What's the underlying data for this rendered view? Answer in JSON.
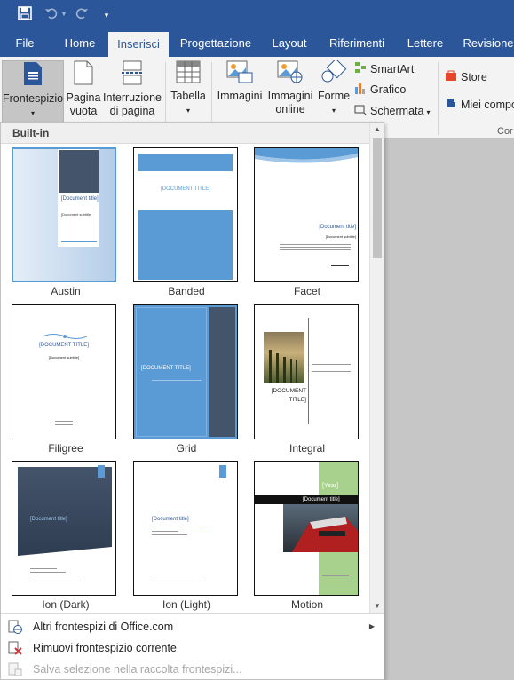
{
  "qat": {
    "save_icon": "save-icon",
    "undo_icon": "undo-icon",
    "redo_icon": "redo-icon",
    "customize": "▾"
  },
  "tabs": [
    {
      "label": "File"
    },
    {
      "label": "Home"
    },
    {
      "label": "Inserisci"
    },
    {
      "label": "Progettazione"
    },
    {
      "label": "Layout"
    },
    {
      "label": "Riferimenti"
    },
    {
      "label": "Lettere"
    },
    {
      "label": "Revisione"
    }
  ],
  "ribbon": {
    "frontespizio": "Frontespizio",
    "pagina_vuota_1": "Pagina",
    "pagina_vuota_2": "vuota",
    "interruzione_1": "Interruzione",
    "interruzione_2": "di pagina",
    "tabella": "Tabella",
    "immagini": "Immagini",
    "immagini_online_1": "Immagini",
    "immagini_online_2": "online",
    "forme": "Forme",
    "smartart": "SmartArt",
    "grafico": "Grafico",
    "schermata": "Schermata",
    "store": "Store",
    "miei_componenti": "Miei compo",
    "group_cor": "Cor"
  },
  "gallery": {
    "section": "Built-in",
    "items": [
      {
        "label": "Austin",
        "title": "[Document title]",
        "subtitle": "[Document subtitle]"
      },
      {
        "label": "Banded",
        "title": "[DOCUMENT TITLE]"
      },
      {
        "label": "Facet",
        "title": "[Document title]",
        "subtitle": "[Document subtitle]"
      },
      {
        "label": "Filigree",
        "title": "[DOCUMENT TITLE]",
        "subtitle": "[Document subtitle]"
      },
      {
        "label": "Grid",
        "title": "[DOCUMENT TITLE]"
      },
      {
        "label": "Integral",
        "title": "[DOCUMENT TITLE]"
      },
      {
        "label": "Ion (Dark)",
        "title": "[Document title]"
      },
      {
        "label": "Ion (Light)",
        "title": "[Document title]"
      },
      {
        "label": "Motion",
        "title": "[Document title]",
        "year": "[Year]"
      }
    ]
  },
  "menu": {
    "altri": "Altri frontespizi di Office.com",
    "rimuovi": "Rimuovi frontespizio corrente",
    "salva": "Salva selezione nella raccolta frontespizi..."
  },
  "colors": {
    "brand": "#2b579a",
    "ribbon_bg": "#f3f3f3",
    "selected": "#c5c5c5",
    "accent_blue": "#5b9bd5",
    "dark_slate": "#44546a"
  }
}
